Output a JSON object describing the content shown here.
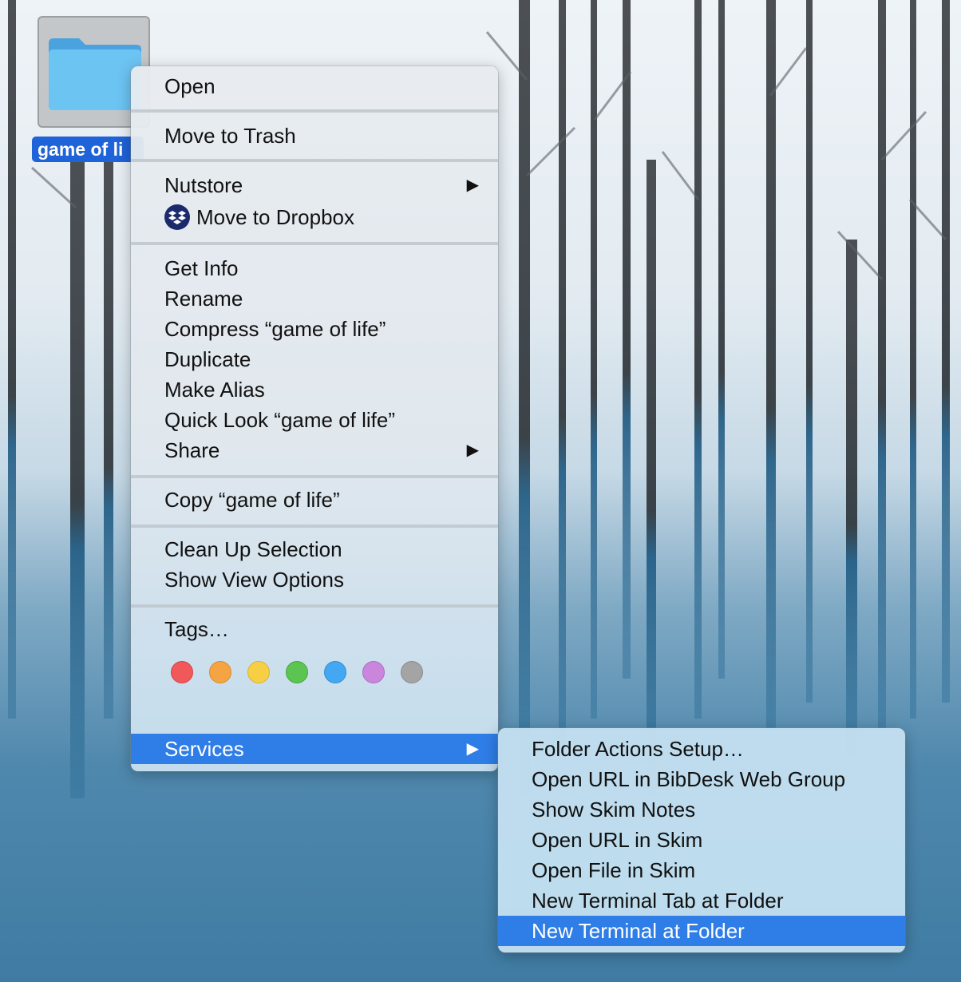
{
  "desktop": {
    "folder_name": "game of life",
    "folder_label_visible": "game of li"
  },
  "context_menu": {
    "open": "Open",
    "move_to_trash": "Move to Trash",
    "nutstore": "Nutstore",
    "move_to_dropbox": "Move to Dropbox",
    "get_info": "Get Info",
    "rename": "Rename",
    "compress": "Compress “game of life”",
    "duplicate": "Duplicate",
    "make_alias": "Make Alias",
    "quick_look": "Quick Look “game of life”",
    "share": "Share",
    "copy": "Copy “game of life”",
    "clean_up_selection": "Clean Up Selection",
    "show_view_options": "Show View Options",
    "tags": "Tags…",
    "services": "Services",
    "submenu_arrow": "▶"
  },
  "tag_colors": [
    {
      "name": "red",
      "color": "#f0585a"
    },
    {
      "name": "orange",
      "color": "#f5a443"
    },
    {
      "name": "yellow",
      "color": "#f6cf44"
    },
    {
      "name": "green",
      "color": "#5cc551"
    },
    {
      "name": "blue",
      "color": "#43a8f1"
    },
    {
      "name": "purple",
      "color": "#c986dc"
    },
    {
      "name": "gray",
      "color": "#a4a4a4"
    }
  ],
  "services_menu": {
    "items": [
      "Folder Actions Setup…",
      "Open URL in BibDesk Web Group",
      "Show Skim Notes",
      "Open URL in Skim",
      "Open File in Skim",
      "New Terminal Tab at Folder",
      "New Terminal at Folder"
    ],
    "highlighted": "New Terminal at Folder"
  },
  "colors": {
    "highlight": "#2f7de6",
    "selection_label": "#1e63d7",
    "folder": "#5ab7ee"
  }
}
